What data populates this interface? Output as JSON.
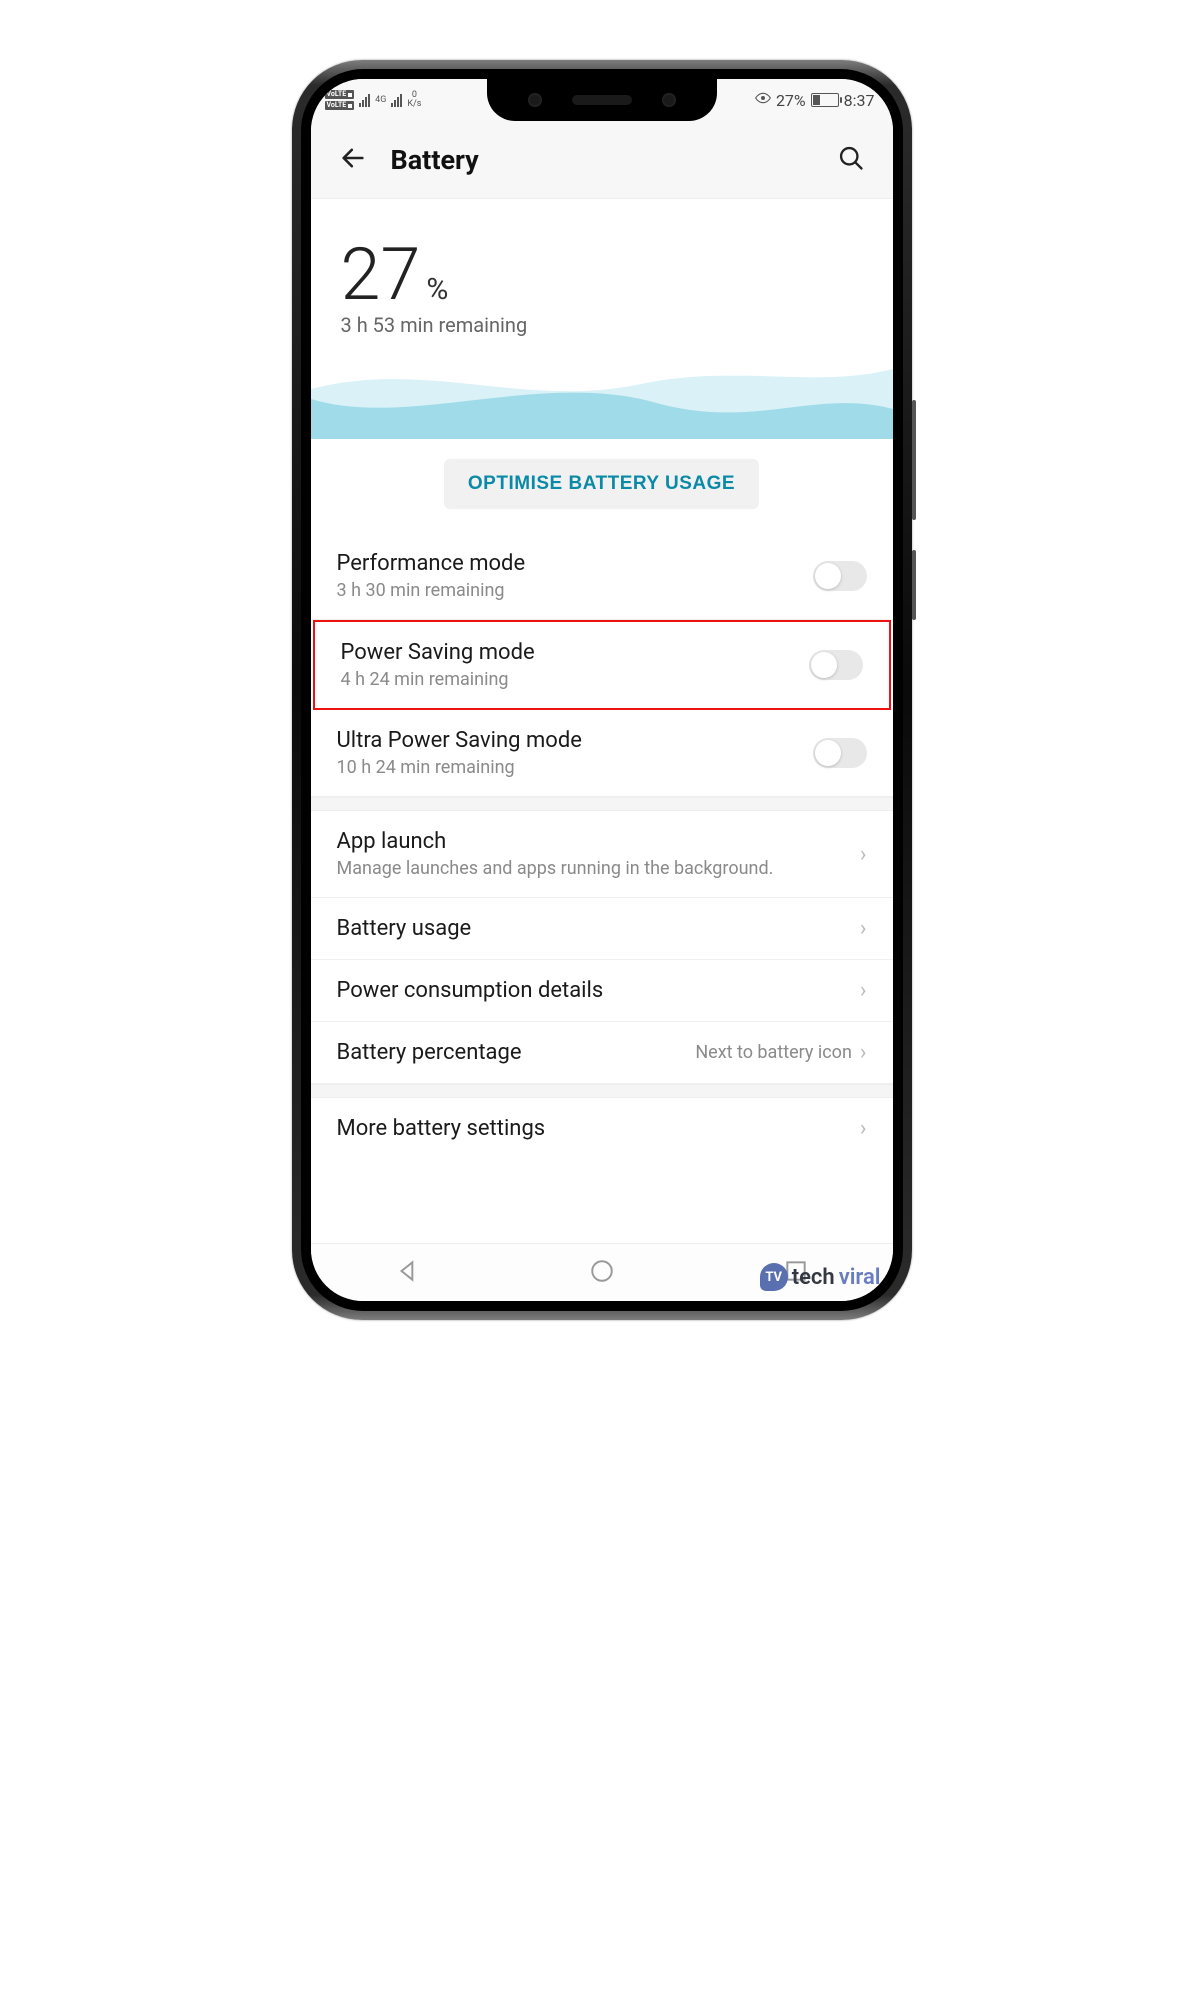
{
  "status": {
    "volte": "VoLTE",
    "net_type": "4G",
    "speed_top": "0",
    "speed_unit": "K/s",
    "battery_pct": "27%",
    "time": "8:37"
  },
  "header": {
    "title": "Battery"
  },
  "hero": {
    "pct": "27",
    "pct_sign": "%",
    "remaining": "3 h 53 min remaining"
  },
  "optimize_label": "OPTIMISE BATTERY USAGE",
  "modes": [
    {
      "title": "Performance mode",
      "sub": "3 h 30 min remaining"
    },
    {
      "title": "Power Saving mode",
      "sub": "4 h 24 min remaining"
    },
    {
      "title": "Ultra Power Saving mode",
      "sub": "10 h 24 min remaining"
    }
  ],
  "items": [
    {
      "title": "App launch",
      "sub": "Manage launches and apps running in the background."
    },
    {
      "title": "Battery usage"
    },
    {
      "title": "Power consumption details"
    },
    {
      "title": "Battery percentage",
      "value": "Next to battery icon"
    }
  ],
  "more_label": "More battery settings",
  "watermark": {
    "tech": "tech",
    "viral": "viral",
    "badge": "TV"
  }
}
